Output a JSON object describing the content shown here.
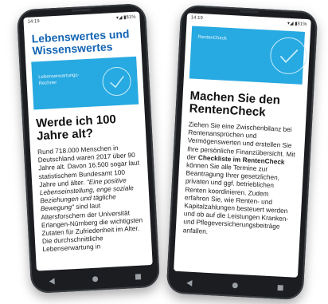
{
  "phone1": {
    "status_time": "14:19",
    "status_right": "▾◢ ▮81%",
    "section_title": "Lebenswertes und Wissenswertes",
    "banner_label": "Lebenserwartungs-Rechner",
    "headline": "Werde ich 100 Jahre alt?",
    "body_plain_1": "Rund 718.000 Menschen in Deutschland waren 2017 über 90 Jahre alt. Davon 16.500 sogar laut statistischem Bundesamt 100 Jahre und älter. ",
    "body_italic": "\"Eine positive Lebenseinstellung, enge soziale Beziehungen und tägliche Bewegung\"",
    "body_plain_2": " sind laut Altersforschern der Universität Erlangen-Nürnberg die wichtigsten Zutaten für Zufriedenheit im Alter. Die durchschnittliche Lebenserwartung in"
  },
  "phone2": {
    "status_time": "14:19",
    "status_right": "▾◢ ▮81%",
    "banner_label": "RentenCheck",
    "headline": "Machen Sie den RentenCheck",
    "body_plain_1": "Ziehen Sie eine Zwischenbilanz bei Rentenansprüchen und Vermögenswerten und erstellen Sie Ihre persönliche Finanzübersicht. Mit der ",
    "body_bold": "Checkliste im RentenCheck",
    "body_plain_2": " können Sie alle Termine zur Beantragung Ihrer gesetzlichen, privaten und ggf. betrieblichen Renten koordinieren. Zudem erfahren Sie, wie Renten- und Kapitalzahlungen besteuert werden und ob auf die Leistungen Kranken- und Pflegeversicherungsbeiträge anfallen."
  },
  "nav": {
    "back": "◀",
    "home": "●",
    "recents": "■"
  },
  "colors": {
    "brand_blue": "#1465b4",
    "banner_blue": "#27a9e1",
    "phone_frame": "#1b1d21"
  }
}
